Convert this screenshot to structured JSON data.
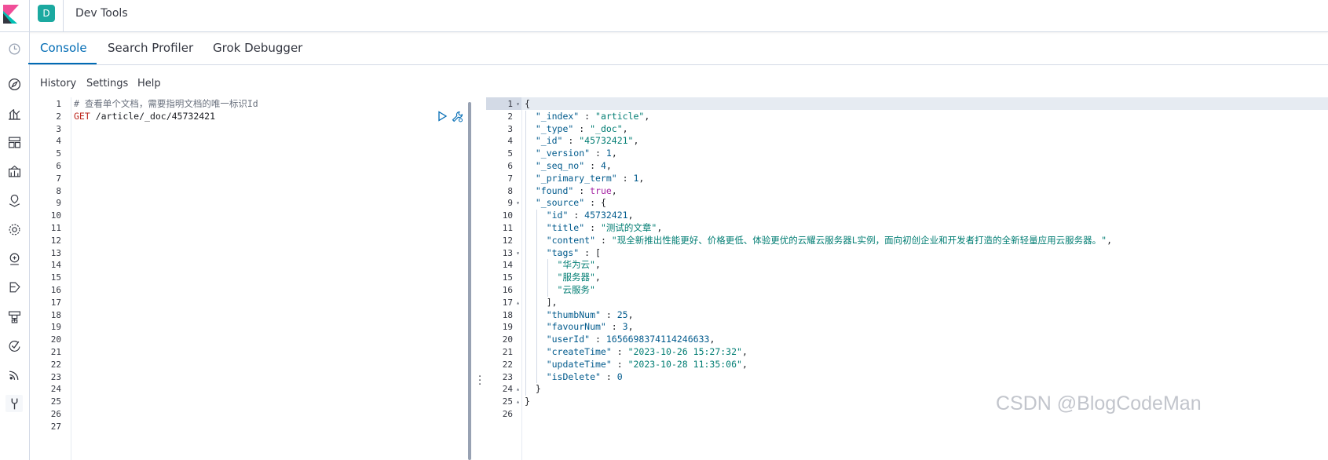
{
  "header": {
    "app_title": "Dev Tools",
    "avatar_letter": "D"
  },
  "tabs": [
    {
      "label": "Console",
      "active": true
    },
    {
      "label": "Search Profiler",
      "active": false
    },
    {
      "label": "Grok Debugger",
      "active": false
    }
  ],
  "submenu": {
    "history": "History",
    "settings": "Settings",
    "help": "Help"
  },
  "sidenav_icons": [
    "recent-icon",
    "discover-icon",
    "visualize-icon",
    "dashboard-icon",
    "canvas-icon",
    "maps-icon",
    "ml-icon",
    "graph-icon",
    "siem-icon",
    "infrastructure-icon",
    "apm-icon",
    "uptime-icon",
    "devtools-icon"
  ],
  "request": {
    "line_count": 27,
    "comment": "# 查看单个文档，需要指明文档的唯一标识Id",
    "method": "GET",
    "path": " /article/_doc/45732421"
  },
  "response": {
    "line_count": 26,
    "lines": [
      [
        {
          "t": "pt",
          "v": "{"
        }
      ],
      [
        {
          "t": "key",
          "v": "  \"_index\""
        },
        {
          "t": "pt",
          "v": " : "
        },
        {
          "t": "str",
          "v": "\"article\""
        },
        {
          "t": "pt",
          "v": ","
        }
      ],
      [
        {
          "t": "key",
          "v": "  \"_type\""
        },
        {
          "t": "pt",
          "v": " : "
        },
        {
          "t": "str",
          "v": "\"_doc\""
        },
        {
          "t": "pt",
          "v": ","
        }
      ],
      [
        {
          "t": "key",
          "v": "  \"_id\""
        },
        {
          "t": "pt",
          "v": " : "
        },
        {
          "t": "str",
          "v": "\"45732421\""
        },
        {
          "t": "pt",
          "v": ","
        }
      ],
      [
        {
          "t": "key",
          "v": "  \"_version\""
        },
        {
          "t": "pt",
          "v": " : "
        },
        {
          "t": "num",
          "v": "1"
        },
        {
          "t": "pt",
          "v": ","
        }
      ],
      [
        {
          "t": "key",
          "v": "  \"_seq_no\""
        },
        {
          "t": "pt",
          "v": " : "
        },
        {
          "t": "num",
          "v": "4"
        },
        {
          "t": "pt",
          "v": ","
        }
      ],
      [
        {
          "t": "key",
          "v": "  \"_primary_term\""
        },
        {
          "t": "pt",
          "v": " : "
        },
        {
          "t": "num",
          "v": "1"
        },
        {
          "t": "pt",
          "v": ","
        }
      ],
      [
        {
          "t": "key",
          "v": "  \"found\""
        },
        {
          "t": "pt",
          "v": " : "
        },
        {
          "t": "bool",
          "v": "true"
        },
        {
          "t": "pt",
          "v": ","
        }
      ],
      [
        {
          "t": "key",
          "v": "  \"_source\""
        },
        {
          "t": "pt",
          "v": " : {"
        }
      ],
      [
        {
          "t": "key",
          "v": "    \"id\""
        },
        {
          "t": "pt",
          "v": " : "
        },
        {
          "t": "num",
          "v": "45732421"
        },
        {
          "t": "pt",
          "v": ","
        }
      ],
      [
        {
          "t": "key",
          "v": "    \"title\""
        },
        {
          "t": "pt",
          "v": " : "
        },
        {
          "t": "str",
          "v": "\"测试的文章\""
        },
        {
          "t": "pt",
          "v": ","
        }
      ],
      [
        {
          "t": "key",
          "v": "    \"content\""
        },
        {
          "t": "pt",
          "v": " : "
        },
        {
          "t": "str",
          "v": "\"现全新推出性能更好、价格更低、体验更优的云耀云服务器L实例，面向初创企业和开发者打造的全新轻量应用云服务器。\""
        },
        {
          "t": "pt",
          "v": ","
        }
      ],
      [
        {
          "t": "key",
          "v": "    \"tags\""
        },
        {
          "t": "pt",
          "v": " : ["
        }
      ],
      [
        {
          "t": "str",
          "v": "      \"华为云\""
        },
        {
          "t": "pt",
          "v": ","
        }
      ],
      [
        {
          "t": "str",
          "v": "      \"服务器\""
        },
        {
          "t": "pt",
          "v": ","
        }
      ],
      [
        {
          "t": "str",
          "v": "      \"云服务\""
        }
      ],
      [
        {
          "t": "pt",
          "v": "    ],"
        }
      ],
      [
        {
          "t": "key",
          "v": "    \"thumbNum\""
        },
        {
          "t": "pt",
          "v": " : "
        },
        {
          "t": "num",
          "v": "25"
        },
        {
          "t": "pt",
          "v": ","
        }
      ],
      [
        {
          "t": "key",
          "v": "    \"favourNum\""
        },
        {
          "t": "pt",
          "v": " : "
        },
        {
          "t": "num",
          "v": "3"
        },
        {
          "t": "pt",
          "v": ","
        }
      ],
      [
        {
          "t": "key",
          "v": "    \"userId\""
        },
        {
          "t": "pt",
          "v": " : "
        },
        {
          "t": "num",
          "v": "1656698374114246633"
        },
        {
          "t": "pt",
          "v": ","
        }
      ],
      [
        {
          "t": "key",
          "v": "    \"createTime\""
        },
        {
          "t": "pt",
          "v": " : "
        },
        {
          "t": "str",
          "v": "\"2023-10-26 15:27:32\""
        },
        {
          "t": "pt",
          "v": ","
        }
      ],
      [
        {
          "t": "key",
          "v": "    \"updateTime\""
        },
        {
          "t": "pt",
          "v": " : "
        },
        {
          "t": "str",
          "v": "\"2023-10-28 11:35:06\""
        },
        {
          "t": "pt",
          "v": ","
        }
      ],
      [
        {
          "t": "key",
          "v": "    \"isDelete\""
        },
        {
          "t": "pt",
          "v": " : "
        },
        {
          "t": "num",
          "v": "0"
        }
      ],
      [
        {
          "t": "pt",
          "v": "  }"
        }
      ],
      [
        {
          "t": "pt",
          "v": "}"
        }
      ],
      []
    ],
    "fold_open_lines": [
      1,
      9,
      13
    ],
    "fold_close_lines": [
      17,
      24,
      25
    ]
  },
  "watermark": "CSDN @BlogCodeMan",
  "colors": {
    "accent": "#006bb4",
    "avatar": "#1ba9a0",
    "border": "#d3dae6"
  }
}
